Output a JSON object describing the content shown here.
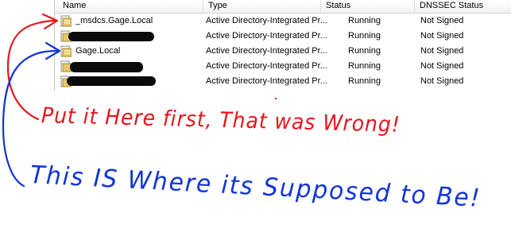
{
  "columns": [
    {
      "label": "Name"
    },
    {
      "label": "Type"
    },
    {
      "label": "Status"
    },
    {
      "label": "DNSSEC Status"
    }
  ],
  "rows": [
    {
      "name": "_msdcs.Gage.Local",
      "redacted": false,
      "type": "Active Directory-Integrated Pr...",
      "status": "Running",
      "dnssec": "Not Signed"
    },
    {
      "name": "",
      "redacted": true,
      "type": "Active Directory-Integrated Pr...",
      "status": "Running",
      "dnssec": "Not Signed"
    },
    {
      "name": "Gage.Local",
      "redacted": false,
      "type": "Active Directory-Integrated Pr...",
      "status": "Running",
      "dnssec": "Not Signed"
    },
    {
      "name": "",
      "redacted": true,
      "type": "Active Directory-Integrated Pr...",
      "status": "Running",
      "dnssec": "Not Signed"
    },
    {
      "name": "",
      "redacted": true,
      "type": "Active Directory-Integrated Pr...",
      "status": "Running",
      "dnssec": "Not Signed"
    }
  ],
  "annotations": {
    "red_text": "Put it Here first, That was Wrong!",
    "blue_text": "This IS Where its Supposed to Be!",
    "red_color": "#e8141b",
    "blue_color": "#1234d8"
  },
  "icons": {
    "zone": "zone-folder-icon"
  }
}
